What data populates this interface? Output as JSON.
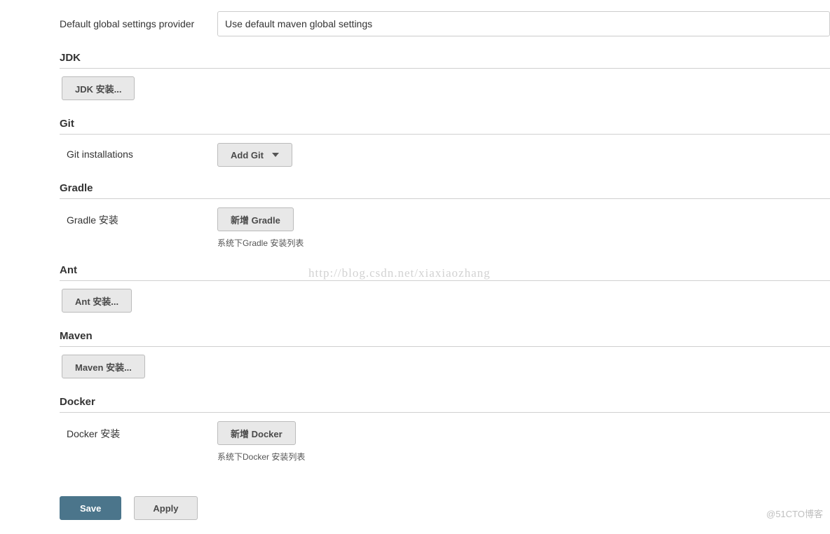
{
  "topField": {
    "label": "Default global settings provider",
    "value": "Use default maven global settings"
  },
  "sections": {
    "jdk": {
      "header": "JDK",
      "installBtn": "JDK 安装..."
    },
    "git": {
      "header": "Git",
      "label": "Git installations",
      "addBtn": "Add Git"
    },
    "gradle": {
      "header": "Gradle",
      "label": "Gradle 安装",
      "addBtn": "新增 Gradle",
      "helper": "系统下Gradle 安装列表"
    },
    "ant": {
      "header": "Ant",
      "installBtn": "Ant 安装..."
    },
    "maven": {
      "header": "Maven",
      "installBtn": "Maven 安装..."
    },
    "docker": {
      "header": "Docker",
      "label": "Docker 安装",
      "addBtn": "新增 Docker",
      "helper": "系统下Docker 安装列表"
    }
  },
  "footer": {
    "save": "Save",
    "apply": "Apply"
  },
  "watermark": "http://blog.csdn.net/xiaxiaozhang",
  "cornerWatermark": "@51CTO博客"
}
